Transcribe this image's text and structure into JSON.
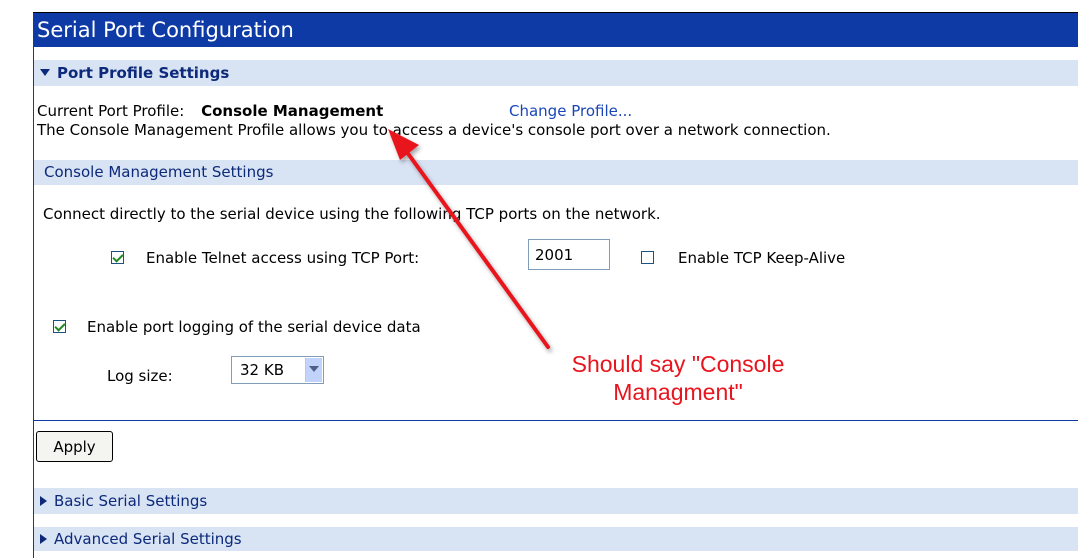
{
  "title": "Serial Port Configuration",
  "sections": {
    "port_profile": {
      "label": "Port Profile Settings",
      "expanded": true
    },
    "basic_serial": {
      "label": "Basic Serial Settings",
      "expanded": false
    },
    "advanced_serial": {
      "label": "Advanced Serial Settings",
      "expanded": false
    }
  },
  "profile": {
    "label": "Current Port Profile:",
    "name": "Console Management",
    "change_link": "Change Profile...",
    "description": "The Console Management Profile allows you to access a device's console port over a network connection."
  },
  "console_settings": {
    "header": "Console Management Settings",
    "intro": "Connect directly to the serial device using the following TCP ports on the network.",
    "telnet": {
      "label": "Enable Telnet access using TCP Port:",
      "checked": true,
      "port": "2001"
    },
    "keepalive": {
      "label": "Enable TCP Keep-Alive",
      "checked": false
    },
    "logging": {
      "label": "Enable port logging of the serial device data",
      "checked": true
    },
    "log_size": {
      "label": "Log size:",
      "value": "32 KB"
    }
  },
  "apply_label": "Apply",
  "annotation": {
    "line1": "Should say \"Console",
    "line2": "Managment\"",
    "color": "#e8141e"
  },
  "colors": {
    "title_bg": "#0d3aa5",
    "section_bg": "#d8e3f4",
    "link": "#1a45b8"
  }
}
